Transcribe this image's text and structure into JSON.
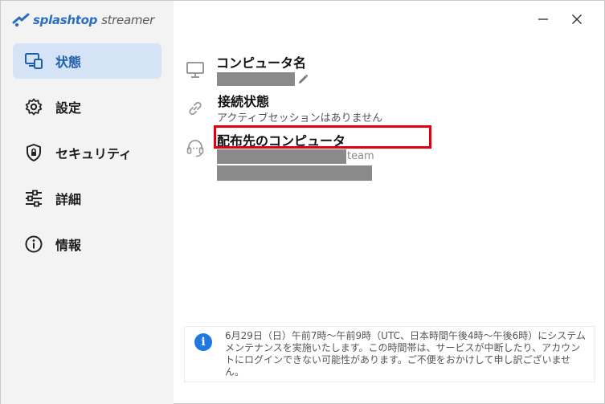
{
  "app": {
    "brand_name": "splashtop",
    "brand_sub": "streamer",
    "accent_color": "#2a6fc1"
  },
  "window_controls": {
    "minimize_icon": "minimize-icon",
    "close_icon": "close-icon"
  },
  "sidebar": {
    "items": [
      {
        "label": "状態",
        "icon": "status-monitor-icon",
        "active": true
      },
      {
        "label": "設定",
        "icon": "gear-icon",
        "active": false
      },
      {
        "label": "セキュリティ",
        "icon": "shield-lock-icon",
        "active": false
      },
      {
        "label": "詳細",
        "icon": "sliders-icon",
        "active": false
      },
      {
        "label": "情報",
        "icon": "info-icon",
        "active": false
      }
    ]
  },
  "main": {
    "computer_name_title": "コンピュータ名",
    "connection_status_title": "接続状態",
    "connection_status_value": "アクティブセッションはありません",
    "deploy_target_title": "配布先のコンピュータ",
    "team_suffix": "team"
  },
  "notice": {
    "icon": "info-icon",
    "text": "6月29日（日）午前7時〜午前9時（UTC、日本時間午後4時〜午後6時）にシステムメンテナンスを実施いたします。この時間帯は、サービスが中断したり、アカウントにログインできない可能性があります。ご不便をおかけして申し訳ございません。"
  }
}
